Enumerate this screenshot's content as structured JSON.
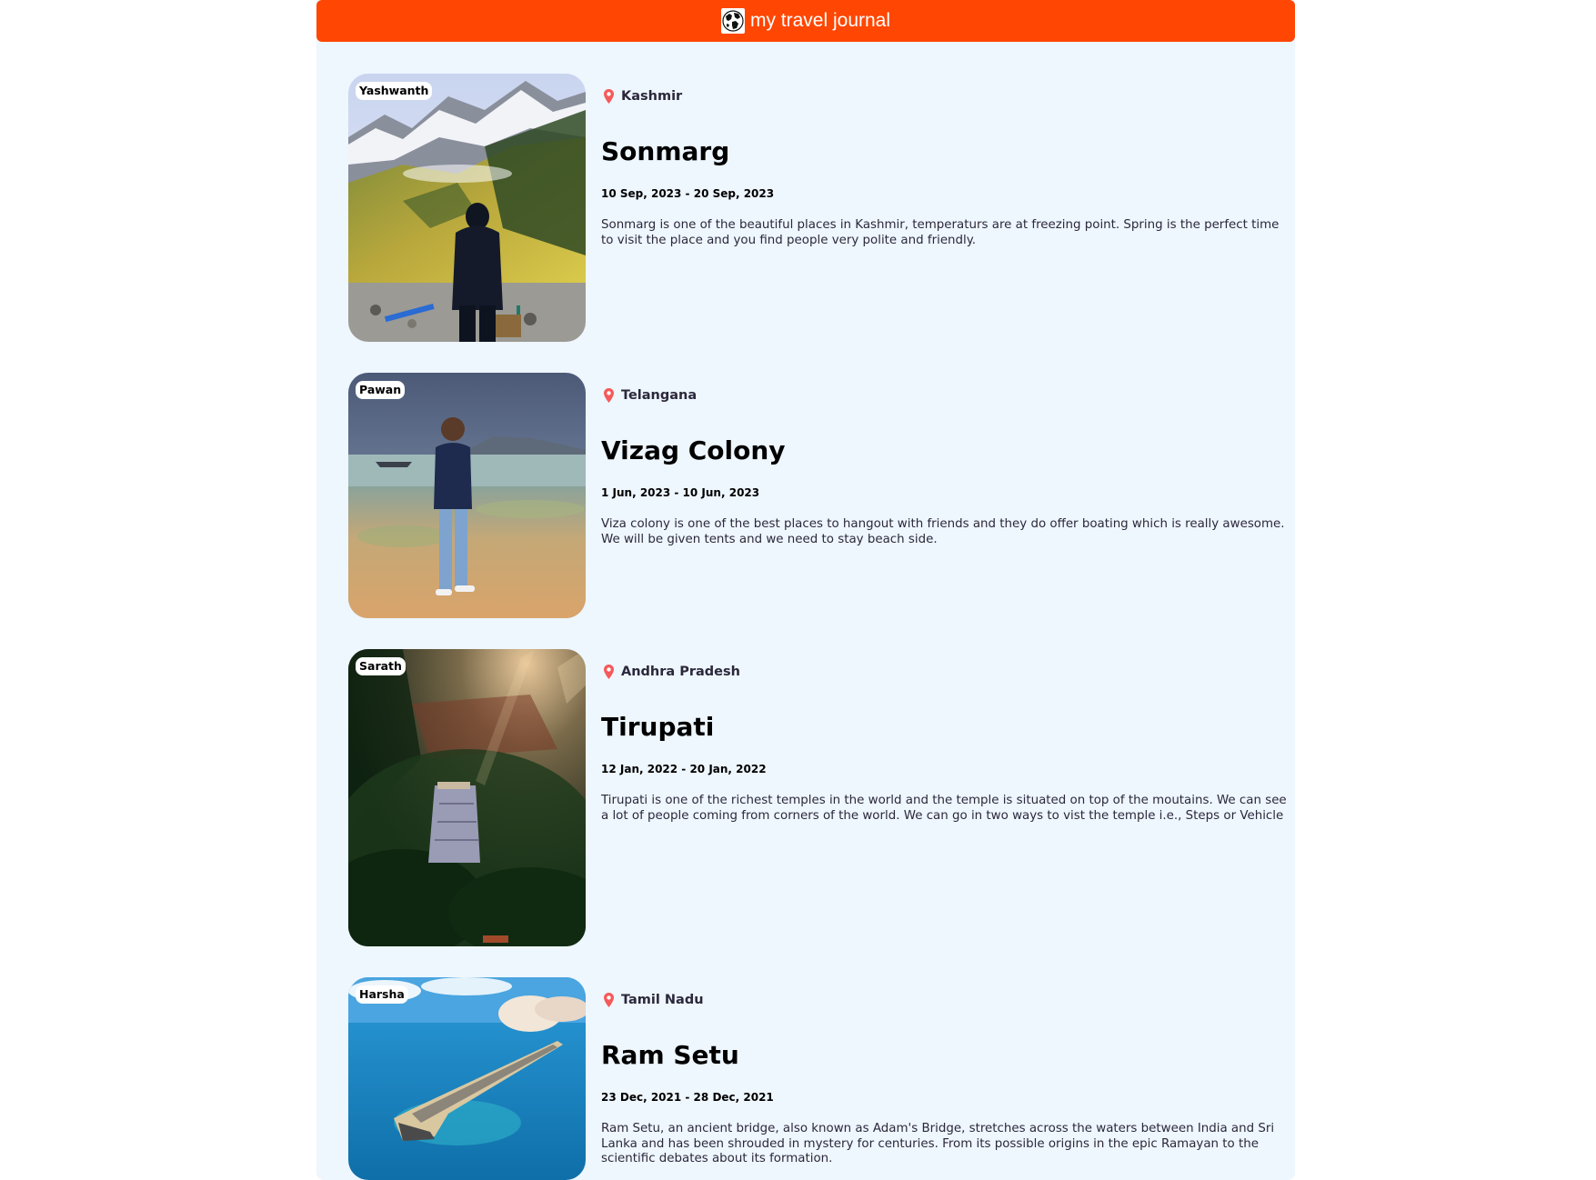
{
  "navbar": {
    "title": "my travel journal",
    "logo_icon": "globe-icon",
    "background_color": "#ff4602"
  },
  "entries": [
    {
      "owner": "Yashwanth",
      "location": "Kashmir",
      "title": "Sonmarg",
      "dates": "10 Sep, 2023 - 20 Sep, 2023",
      "description": "Sonmarg is one of the beautiful places in Kashmir, temperaturs are at freezing point. Spring is the perfect time to visit the place and you find people very polite and friendly."
    },
    {
      "owner": "Pawan",
      "location": "Telangana",
      "title": "Vizag Colony",
      "dates": "1 Jun, 2023 - 10 Jun, 2023",
      "description": "Viza colony is one of the best places to hangout with friends and they do offer boating which is really awesome. We will be given tents and we need to stay beach side."
    },
    {
      "owner": "Sarath",
      "location": "Andhra Pradesh",
      "title": "Tirupati",
      "dates": "12 Jan, 2022 - 20 Jan, 2022",
      "description": "Tirupati is one of the richest temples in the world and the temple is situated on top of the moutains. We can see a lot of people coming from corners of the world. We can go in two ways to vist the temple i.e., Steps or Vehicle"
    },
    {
      "owner": "Harsha",
      "location": "Tamil Nadu",
      "title": "Ram Setu",
      "dates": "23 Dec, 2021 - 28 Dec, 2021",
      "description": "Ram Setu, an ancient bridge, also known as Adam's Bridge, stretches across the waters between India and Sri Lanka and has been shrouded in mystery for centuries. From its possible origins in the epic Ramayan to the scientific debates about its formation."
    }
  ],
  "icons": {
    "location": "map-pin-icon"
  },
  "colors": {
    "accent": "#ff4602",
    "pin": "#f55a5a",
    "page_background": "#eef6fe"
  }
}
